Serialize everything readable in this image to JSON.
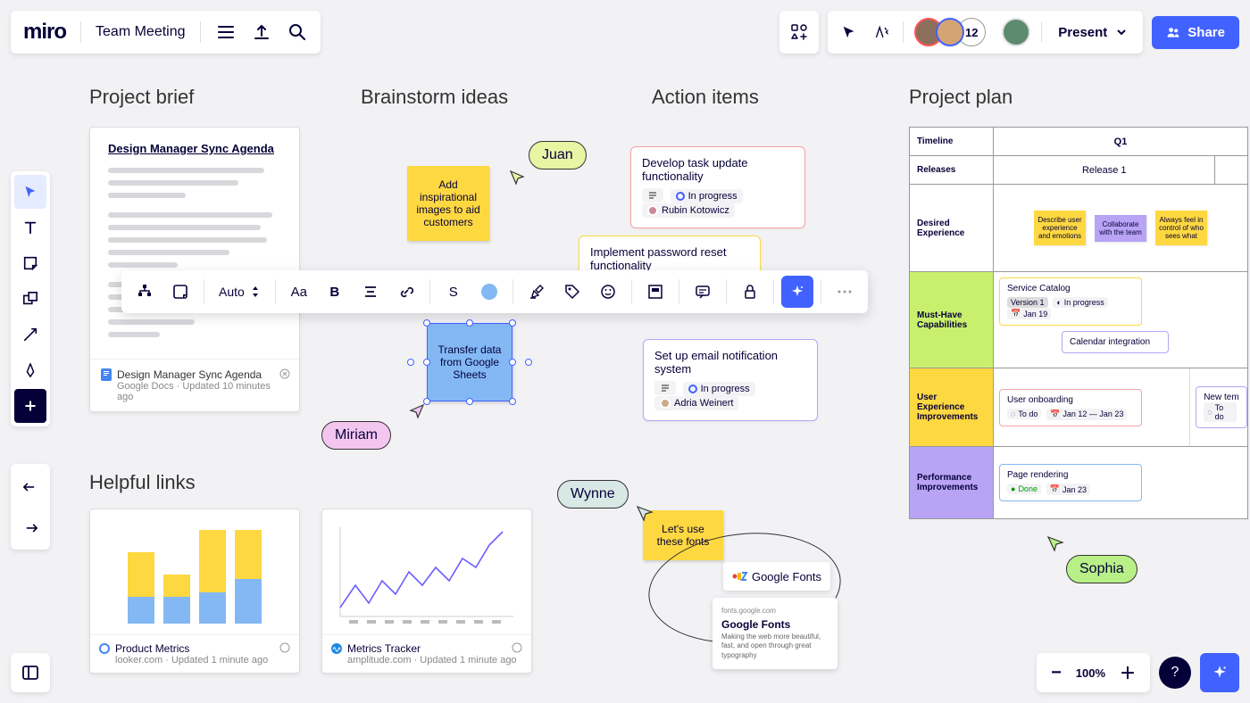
{
  "app": {
    "logo": "miro",
    "board_title": "Team Meeting"
  },
  "topbar": {
    "participant_count": "12",
    "present_label": "Present",
    "share_label": "Share"
  },
  "sections": {
    "brief": "Project brief",
    "brainstorm": "Brainstorm ideas",
    "actions": "Action items",
    "plan": "Project plan",
    "links": "Helpful links"
  },
  "doc_card": {
    "heading": "Design Manager Sync Agenda",
    "footer_title": "Design Manager Sync Agenda",
    "footer_sub": "Google Docs · Updated 10 minutes ago"
  },
  "stickies": {
    "inspire": "Add inspirational images to aid customers",
    "transfer": "Transfer data from Google Sheets",
    "fonts": "Let's use these fonts"
  },
  "cursors": {
    "juan": "Juan",
    "miriam": "Miriam",
    "wynne": "Wynne",
    "sophia": "Sophia"
  },
  "action_items": {
    "a1": {
      "title": "Develop task update functionality",
      "status": "In progress",
      "assignee": "Rubin Kotowicz"
    },
    "a2": {
      "title": "Implement password reset functionality"
    },
    "a3": {
      "title": "Set up email notification system",
      "status": "In progress",
      "assignee": "Adria Weinert"
    }
  },
  "context_toolbar": {
    "auto_label": "Auto",
    "size_label": "S",
    "font_label": "Aa",
    "bold_label": "B"
  },
  "link_cards": {
    "metrics": {
      "title": "Product Metrics",
      "sub": "looker.com · Updated 1 minute ago"
    },
    "tracker": {
      "title": "Metrics Tracker",
      "sub": "amplitude.com · Updated 1 minute ago"
    }
  },
  "gfonts": {
    "logo_text": "Google Fonts",
    "card_host": "fonts.google.com",
    "card_title": "Google Fonts",
    "card_desc": "Making the web more beautiful, fast, and open through great typography"
  },
  "plan": {
    "headers": {
      "timeline": "Timeline",
      "q1": "Q1",
      "releases": "Releases",
      "release1": "Release 1"
    },
    "rows": {
      "desired": {
        "label": "Desired Experience",
        "s1": "Describe user experience and emotions",
        "s2": "Collaborate with the team",
        "s3": "Always feel in control of who sees what"
      },
      "musthave": {
        "label": "Must-Have Capabilities",
        "card_title": "Service Catalog",
        "chip_version": "Version 1",
        "chip_status": "In progress",
        "chip_date": "Jan 19",
        "card2": "Calendar integration"
      },
      "ux": {
        "label": "User Experience Improvements",
        "card_title": "User onboarding",
        "chip_status": "To do",
        "chip_date": "Jan 12 — Jan 23",
        "card2": "New tem",
        "chip2_status": "To do"
      },
      "perf": {
        "label": "Performance Improvements",
        "card_title": "Page rendering",
        "chip_status": "Done",
        "chip_date": "Jan 23"
      }
    }
  },
  "zoom": {
    "level": "100%"
  }
}
